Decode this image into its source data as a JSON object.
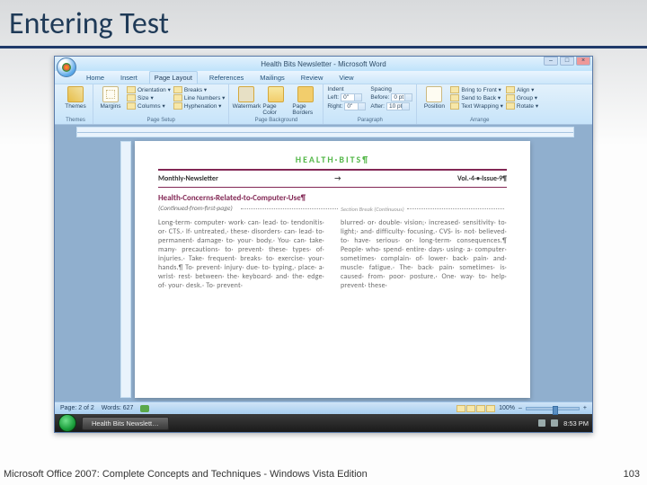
{
  "slide": {
    "title": "Entering Test",
    "footer_text": "Microsoft Office 2007: Complete Concepts and Techniques - Windows Vista Edition",
    "page_number": "103"
  },
  "window": {
    "title": "Health Bits Newsletter - Microsoft Word",
    "controls": {
      "min": "–",
      "max": "□",
      "close": "×"
    }
  },
  "tabs": {
    "items": [
      "Home",
      "Insert",
      "Page Layout",
      "References",
      "Mailings",
      "Review",
      "View"
    ],
    "active_index": 2
  },
  "ribbon": {
    "themes": {
      "big": "Themes",
      "group": "Themes"
    },
    "page_setup": {
      "big": "Margins",
      "items": [
        "Orientation ▾",
        "Size ▾",
        "Columns ▾"
      ],
      "extra": [
        "Breaks ▾",
        "Line Numbers ▾",
        "Hyphenation ▾"
      ],
      "group": "Page Setup"
    },
    "page_bg": {
      "items": [
        "Watermark",
        "Page Color",
        "Page Borders"
      ],
      "group": "Page Background"
    },
    "paragraph": {
      "indent_label": "Indent",
      "spacing_label": "Spacing",
      "left_label": "Left:",
      "left_val": "0\"",
      "right_label": "Right:",
      "right_val": "0\"",
      "before_label": "Before:",
      "before_val": "0 pt",
      "after_label": "After:",
      "after_val": "10 pt",
      "group": "Paragraph"
    },
    "arrange": {
      "big": "Position",
      "items": [
        "Bring to Front ▾",
        "Send to Back ▾",
        "Text Wrapping ▾"
      ],
      "extra": [
        "Align ▾",
        "Group ▾",
        "Rotate ▾"
      ],
      "group": "Arrange"
    }
  },
  "document": {
    "title": "HEALTH·BITS¶",
    "row_left": "Monthly·Newsletter",
    "row_tab": "→",
    "row_right": "Vol.·4·•·Issue·9¶",
    "article": "Health·Concerns·Related·to·Computer·Use¶",
    "continued": "(Continued·from·first·page)",
    "section_break": "Section Break (Continuous)",
    "col1": "Long-term· computer· work· can· lead· to· tendonitis· or· CTS.· If· untreated,· these· disorders· can· lead· to· permanent· damage· to· your· body.· You· can· take· many· precautions· to· prevent· these· types· of· injuries.· Take· frequent· breaks· to· exercise· your· hands.¶ To· prevent· injury· due· to· typing,· place· a· wrist· rest· between· the· keyboard· and· the· edge· of· your· desk.· To· prevent·",
    "col2": "blurred· or· double· vision;· increased· sensitivity· to· light;· and· difficulty· focusing.· CVS· is· not· believed· to· have· serious· or· long-term· consequences.¶\nPeople· who· spend· entire· days· using· a· computer· sometimes· complain· of· lower· back· pain· and· muscle· fatigue.· The· back· pain· sometimes· is· caused· from· poor· posture.· One· way· to· help· prevent· these·"
  },
  "statusbar": {
    "page": "Page: 2 of 2",
    "words": "Words: 627",
    "zoom": "100%"
  },
  "taskbar": {
    "app": "Health Bits Newslett…",
    "time": "8:53 PM"
  }
}
